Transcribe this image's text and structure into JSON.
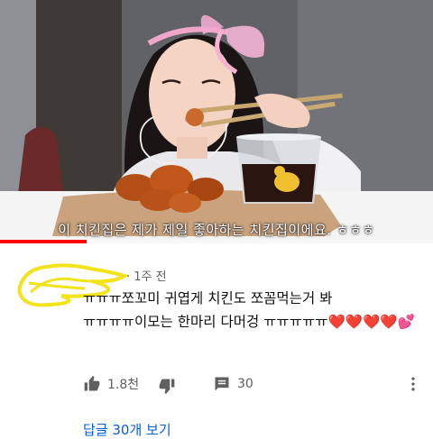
{
  "video": {
    "subtitle": "이 치킨집은 제가 제일 좋아하는 치킨집이에요. ㅎㅎㅎ",
    "progress_fraction": 0.2
  },
  "comment": {
    "time": "· 1주 전",
    "text": "ㅠㅠㅠ쪼꼬미 귀엽게 치킨도 쪼꼼먹는거 봐 ㅠㅠㅠㅠ이모는 한마리 다머겅 ㅠㅠㅠㅠㅠ❤️❤️❤️❤️💕",
    "likes": "1.8천",
    "reply_count": "30",
    "view_replies": "답글 30개 보기"
  },
  "icons": {
    "like": "thumbs-up-icon",
    "dislike": "thumbs-down-icon",
    "reply": "comment-icon",
    "menu": "more-vertical-icon"
  },
  "colors": {
    "progress": "#ff0000",
    "link": "#065fd4",
    "avatar_scribble": "#f2e31a"
  }
}
